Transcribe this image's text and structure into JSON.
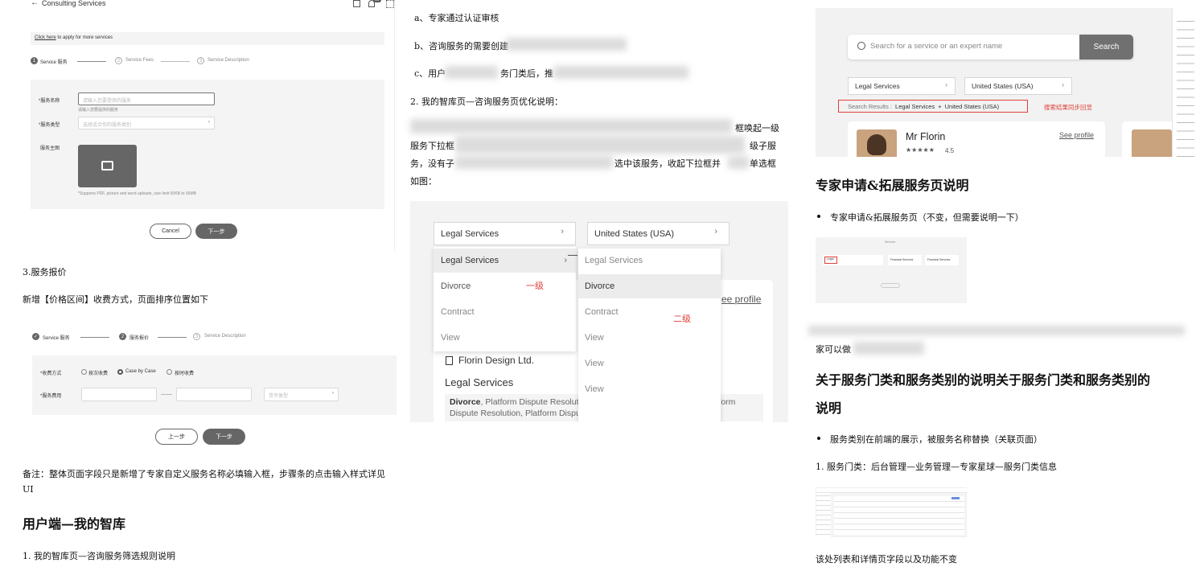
{
  "left": {
    "shot1": {
      "title": "Consulting Services",
      "badge": "10",
      "apply_link": "Click here",
      "apply_text": "to apply for more services",
      "steps": [
        "Service 服务",
        "Service Fees",
        "Service Description"
      ],
      "step_nums": [
        "1",
        "2",
        "3"
      ],
      "name_label": "*服务名称",
      "name_placeholder": "请输入您要提供的服务",
      "name_hint": "请输入您要提供的服务",
      "type_label": "*服务类型",
      "type_placeholder": "选择适合你的服务类别",
      "image_label": "服务主图",
      "upload_hint": "*Supports PDF, picture and word uploads, size limit 50KB to 55MB",
      "cancel": "Cancel",
      "next": "下一步"
    },
    "section3": "3.服务报价",
    "section3_desc": "新增【价格区间】收费方式，页面排序位置如下",
    "shot2": {
      "steps": [
        "Service 服务",
        "服务报价",
        "Service Description"
      ],
      "step_nums": [
        "2",
        "3"
      ],
      "method_label": "*收费方式",
      "options": [
        "按次收费",
        "Case by Case",
        "按时收费"
      ],
      "fee_label": "*服务费用",
      "currency_placeholder": "货币类型",
      "prev": "上一步",
      "next": "下一步"
    },
    "note_line1": "备注：整体页面字段只是新增了专家自定义服务名称必填输入框，步骤条的点击输入样式详见",
    "note_line2": "UI",
    "heading": "用户端—我的智库",
    "item1": "1.  我的智库页—咨询服务筛选规则说明"
  },
  "middle": {
    "a": "a、专家通过认证审核",
    "b": "b、咨询服务的需要创建",
    "c_start": "c、用户",
    "c_mid": "务门类后，推",
    "item2": "2.  我的智库页—咨询服务页优化说明：",
    "para_r1_end": "框唤起一级",
    "para_r2_start": "服务下拉框",
    "para_r2_end": "级子服",
    "para_r3_start": "务，没有子",
    "para_r3_mid": "选中该服务，收起下拉框并",
    "para_r3_end": "单选框",
    "para_r4": "如图：",
    "dd1": "Legal Services",
    "dd2": "United States (USA)",
    "level1": [
      "Legal Services",
      "Divorce",
      "Contract",
      "View"
    ],
    "level2": [
      "Legal Services",
      "Divorce",
      "Contract",
      "View",
      "View",
      "View"
    ],
    "level1_tag": "一级",
    "level2_tag": "二级",
    "see_profile": "ee profile",
    "company": "Florin Design Ltd.",
    "company_service": "Legal Services",
    "desc_bold": "Divorce",
    "desc_line1": ", Platform Dispute Resolution, Platform Dispute Resolution, Platform",
    "desc_line2": "Dispute Resolution, Platform Dispute Resolution, , Platform Dispute ..."
  },
  "right": {
    "search_placeholder": "Search for a service or an expert name",
    "search_btn": "Search",
    "dd1": "Legal Services",
    "dd2": "United States (USA)",
    "results_label": "Search Results :",
    "results_a": "Legal Services",
    "results_plus": "+",
    "results_b": "United States (USA)",
    "results_note": "搜索结果同步回显",
    "expert_name": "Mr Florin",
    "stars": "★★★★★",
    "rating": "4.5",
    "see_profile": "See profile",
    "heading1": "专家申请&拓展服务页说明",
    "bullet1": "专家申请&拓展服务页（不变，但需要说明一下）",
    "mini_title": "Service",
    "mini_cards": [
      "Legal",
      "Financial Services",
      "Financial Services"
    ],
    "line_after_blur": "家可以做",
    "heading2_line1": "关于服务门类和服务类别的说明关于服务门类和服务类别的",
    "heading2_line2": "说明",
    "bullet2": "服务类别在前端的展示，被服务名称替换（关联页面）",
    "item1": "1.  服务门类：后台管理—业务管理—专家星球—服务门类信息",
    "footer": "该处列表和详情页字段以及功能不变"
  },
  "colors": {
    "accent_dark": "#6b6b6b",
    "red": "#e0403a",
    "search_btn": "#707070"
  }
}
